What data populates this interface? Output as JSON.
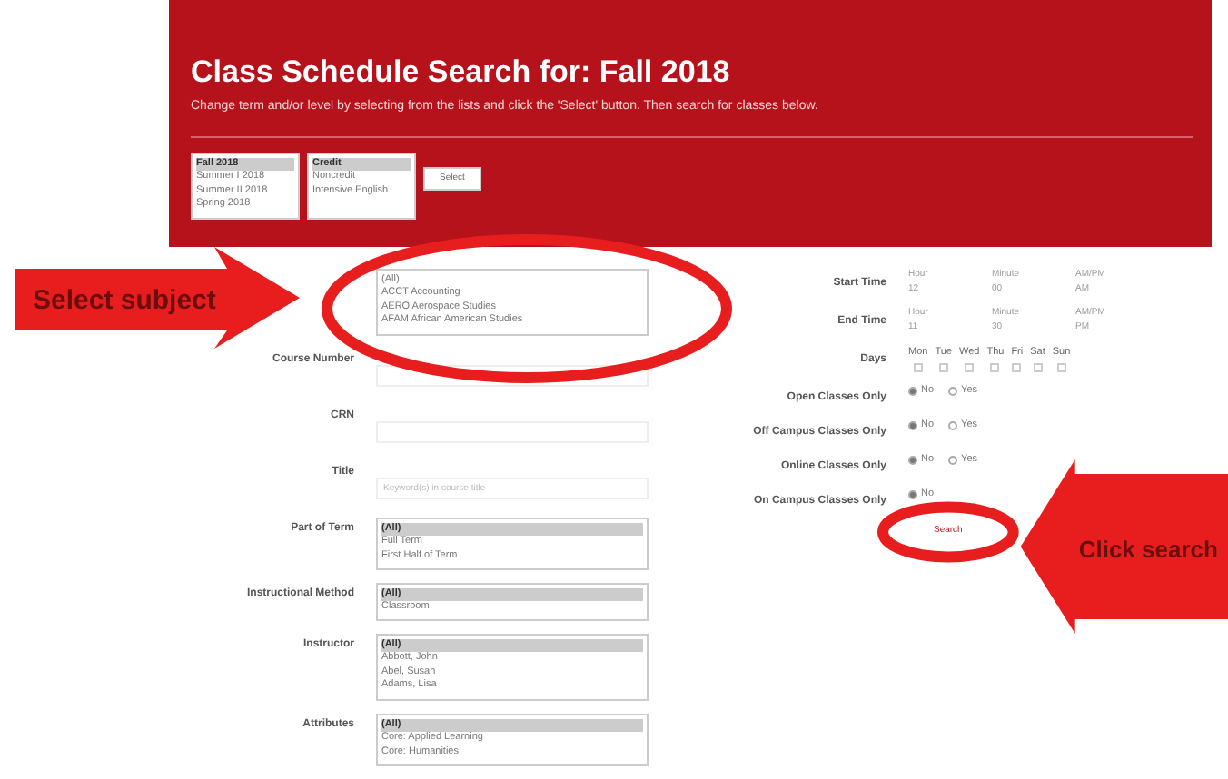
{
  "header": {
    "title": "Class Schedule Search for: Fall 2018",
    "subtitle": "Change term and/or level by selecting from the lists and click the 'Select' button. Then search for classes below.",
    "term_list": [
      {
        "label": "Fall 2018",
        "selected": true
      },
      {
        "label": "Summer I 2018",
        "selected": false
      },
      {
        "label": "Summer II 2018",
        "selected": false
      },
      {
        "label": "Spring 2018",
        "selected": false
      }
    ],
    "level_list": [
      {
        "label": "Credit",
        "selected": true
      },
      {
        "label": "Noncredit",
        "selected": false
      },
      {
        "label": "Intensive English",
        "selected": false
      }
    ],
    "select_button": "Select"
  },
  "left_fields": [
    {
      "kind": "list",
      "items": [
        {
          "label": "(All)",
          "selected": false
        },
        {
          "label": "ACCT Accounting",
          "selected": false
        },
        {
          "label": "AERO Aerospace Studies",
          "selected": false
        },
        {
          "label": "AFAM African American Studies",
          "selected": false
        }
      ]
    },
    {
      "kind": "text",
      "label": "Course Number"
    },
    {
      "kind": "text",
      "label": "CRN"
    },
    {
      "kind": "text",
      "label": "Title",
      "placeholder": "Keyword(s) in course title"
    },
    {
      "kind": "list",
      "label": "Part of Term",
      "items": [
        {
          "label": "(All)",
          "selected": true
        },
        {
          "label": "Full Term",
          "selected": false
        },
        {
          "label": "First Half of Term",
          "selected": false
        }
      ]
    },
    {
      "kind": "list",
      "label": "Instructional Method",
      "items": [
        {
          "label": "(All)",
          "selected": true
        },
        {
          "label": "Classroom",
          "selected": false
        }
      ]
    },
    {
      "kind": "list",
      "label": "Instructor",
      "items": [
        {
          "label": "(All)",
          "selected": true
        },
        {
          "label": "Abbott, John",
          "selected": false
        },
        {
          "label": "Abel, Susan",
          "selected": false
        },
        {
          "label": "Adams, Lisa",
          "selected": false
        }
      ]
    },
    {
      "kind": "list",
      "label": "Attributes",
      "items": [
        {
          "label": "(All)",
          "selected": true
        },
        {
          "label": "Core: Applied Learning",
          "selected": false
        },
        {
          "label": "Core: Humanities",
          "selected": false
        }
      ]
    }
  ],
  "right_fields": [
    {
      "kind": "time",
      "label": "Start Time",
      "parts": [
        {
          "caption": "Hour",
          "value": "12"
        },
        {
          "caption": "Minute",
          "value": "00"
        },
        {
          "caption": "AM/PM",
          "value": "AM"
        }
      ]
    },
    {
      "kind": "time",
      "label": "End Time",
      "parts": [
        {
          "caption": "Hour",
          "value": "11"
        },
        {
          "caption": "Minute",
          "value": "30"
        },
        {
          "caption": "AM/PM",
          "value": "PM"
        }
      ]
    },
    {
      "kind": "days",
      "label": "Days",
      "days": [
        {
          "label": "Mon",
          "checked": false
        },
        {
          "label": "Tue",
          "checked": false
        },
        {
          "label": "Wed",
          "checked": false
        },
        {
          "label": "Thu",
          "checked": false
        },
        {
          "label": "Fri",
          "checked": false
        },
        {
          "label": "Sat",
          "checked": false
        },
        {
          "label": "Sun",
          "checked": false
        }
      ]
    },
    {
      "kind": "yesno",
      "label": "Open Classes Only",
      "options": [
        {
          "label": "No",
          "selected": true
        },
        {
          "label": "Yes",
          "selected": false
        }
      ]
    },
    {
      "kind": "yesno",
      "label": "Off Campus Classes Only",
      "options": [
        {
          "label": "No",
          "selected": true
        },
        {
          "label": "Yes",
          "selected": false
        }
      ]
    },
    {
      "kind": "yesno",
      "label": "Online Classes Only",
      "options": [
        {
          "label": "No",
          "selected": true
        },
        {
          "label": "Yes",
          "selected": false
        }
      ]
    },
    {
      "kind": "yesno",
      "label": "On Campus Classes Only",
      "options": [
        {
          "label": "No",
          "selected": true
        }
      ]
    }
  ],
  "search_button": "Search",
  "annotations": [
    {
      "kind": "right",
      "text": "Select subject"
    },
    {
      "kind": "left",
      "text": "Click search"
    }
  ]
}
